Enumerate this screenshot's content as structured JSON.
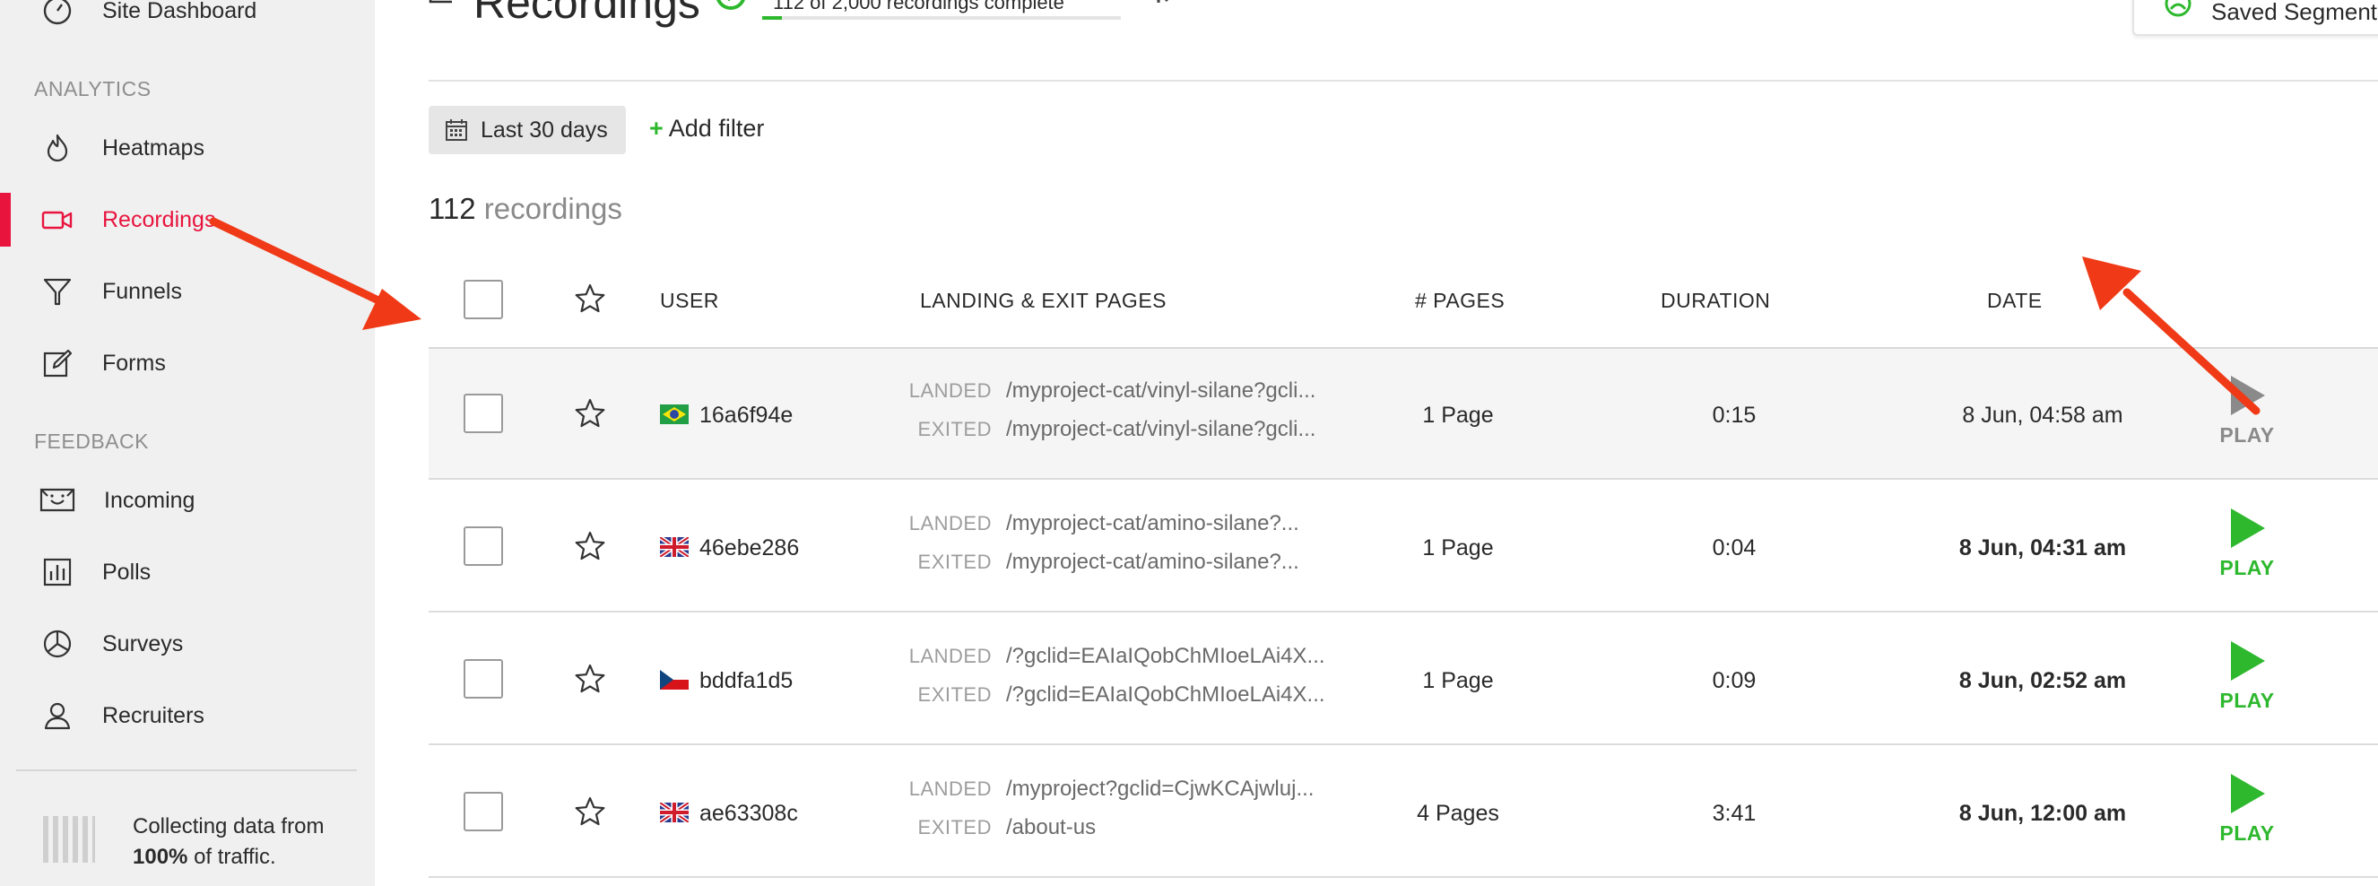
{
  "sidebar": {
    "top_item": {
      "label": "Site Dashboard",
      "icon": "dashboard-icon"
    },
    "analytics_title": "ANALYTICS",
    "analytics_items": [
      {
        "label": "Heatmaps",
        "icon": "flame-icon"
      },
      {
        "label": "Recordings",
        "icon": "video-camera-icon",
        "active": true
      },
      {
        "label": "Funnels",
        "icon": "funnel-icon"
      },
      {
        "label": "Forms",
        "icon": "form-edit-icon"
      }
    ],
    "feedback_title": "FEEDBACK",
    "feedback_items": [
      {
        "label": "Incoming",
        "icon": "inbox-smile-icon"
      },
      {
        "label": "Polls",
        "icon": "bar-chart-icon"
      },
      {
        "label": "Surveys",
        "icon": "pie-chart-icon"
      },
      {
        "label": "Recruiters",
        "icon": "user-icon"
      }
    ],
    "collect": {
      "prefix": "Collecting data from",
      "percent": "100%",
      "suffix": "of traffic."
    },
    "accent_color": "#e8143e"
  },
  "header": {
    "title": "Recordings",
    "progress_text": "112 of 2,000 recordings complete",
    "progress_fraction": 0.056,
    "saved_segments_label": "Saved Segments"
  },
  "filters": {
    "date_range": "Last 30 days",
    "add_filter_label": "Add filter"
  },
  "summary": {
    "count": "112",
    "label": "recordings"
  },
  "table": {
    "columns": [
      "USER",
      "LANDING & EXIT PAGES",
      "# PAGES",
      "DURATION",
      "DATE"
    ],
    "landed_label": "LANDED",
    "exited_label": "EXITED",
    "play_label": "PLAY",
    "rows": [
      {
        "flag": "brazil",
        "user": "16a6f94e",
        "landed": "/myproject-cat/vinyl-silane?gcli...",
        "exited": "/myproject-cat/vinyl-silane?gcli...",
        "pages": "1 Page",
        "duration": "0:15",
        "date": "8 Jun, 04:58 am",
        "watched": true
      },
      {
        "flag": "uk",
        "user": "46ebe286",
        "landed": "/myproject-cat/amino-silane?...",
        "exited": "/myproject-cat/amino-silane?...",
        "pages": "1 Page",
        "duration": "0:04",
        "date": "8 Jun, 04:31 am",
        "watched": false
      },
      {
        "flag": "czech",
        "user": "bddfa1d5",
        "landed": "/?gclid=EAIaIQobChMIoeLAi4X...",
        "exited": "/?gclid=EAIaIQobChMIoeLAi4X...",
        "pages": "1 Page",
        "duration": "0:09",
        "date": "8 Jun, 02:52 am",
        "watched": false
      },
      {
        "flag": "uk",
        "user": "ae63308c",
        "landed": "/myproject?gclid=CjwKCAjwluj...",
        "exited": "/about-us",
        "pages": "4 Pages",
        "duration": "3:41",
        "date": "8 Jun, 12:00 am",
        "watched": false
      }
    ]
  },
  "colors": {
    "play_green": "#2eb82e",
    "annotation_red": "#f03a17"
  }
}
